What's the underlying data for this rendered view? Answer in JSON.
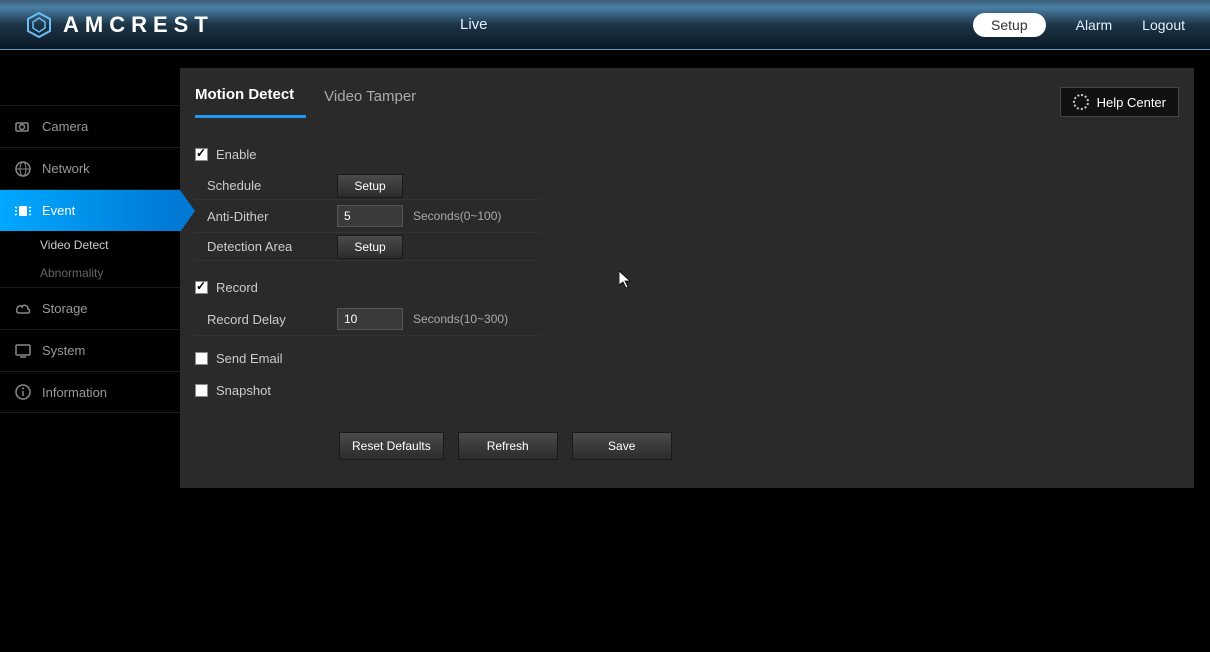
{
  "brand": "AMCREST",
  "header": {
    "center": "Live",
    "nav": {
      "setup": "Setup",
      "alarm": "Alarm",
      "logout": "Logout"
    }
  },
  "sidebar": {
    "camera": "Camera",
    "network": "Network",
    "event": "Event",
    "event_sub": {
      "video_detect": "Video Detect",
      "abnormality": "Abnormality"
    },
    "storage": "Storage",
    "system": "System",
    "information": "Information"
  },
  "tabs": {
    "motion_detect": "Motion Detect",
    "video_tamper": "Video Tamper"
  },
  "help_center": "Help Center",
  "form": {
    "enable": {
      "label": "Enable",
      "checked": true
    },
    "schedule": {
      "label": "Schedule",
      "button": "Setup"
    },
    "anti_dither": {
      "label": "Anti-Dither",
      "value": "5",
      "hint": "Seconds(0~100)"
    },
    "detection_area": {
      "label": "Detection Area",
      "button": "Setup"
    },
    "record": {
      "label": "Record",
      "checked": true
    },
    "record_delay": {
      "label": "Record Delay",
      "value": "10",
      "hint": "Seconds(10~300)"
    },
    "send_email": {
      "label": "Send Email",
      "checked": false
    },
    "snapshot": {
      "label": "Snapshot",
      "checked": false
    }
  },
  "actions": {
    "reset_defaults": "Reset Defaults",
    "refresh": "Refresh",
    "save": "Save"
  }
}
